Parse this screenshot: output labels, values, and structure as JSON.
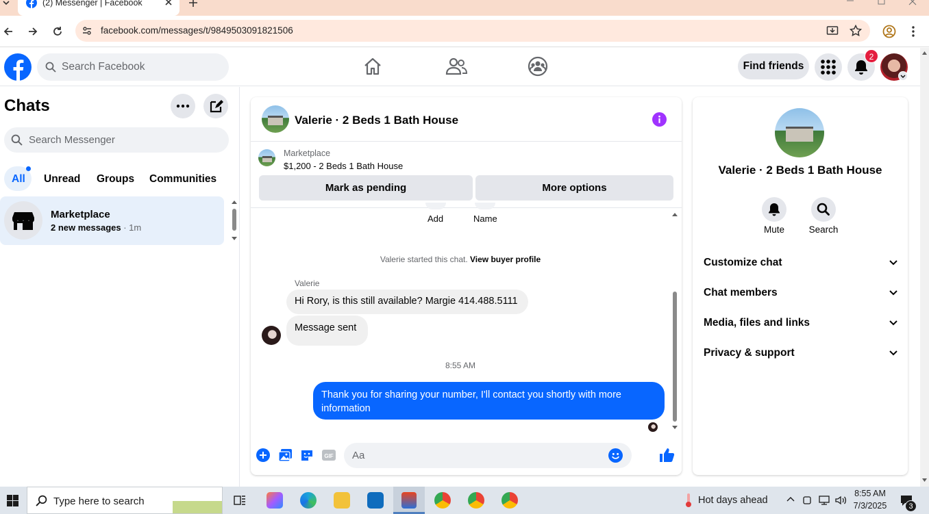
{
  "browser": {
    "tab_title": "(2) Messenger | Facebook",
    "url": "facebook.com/messages/t/9849503091821506"
  },
  "fb_header": {
    "search_placeholder": "Search Facebook",
    "find_friends": "Find friends",
    "notification_count": "2"
  },
  "left": {
    "title": "Chats",
    "search_placeholder": "Search Messenger",
    "filters": [
      "All",
      "Unread",
      "Groups",
      "Communities"
    ],
    "active_filter": "All",
    "chat": {
      "name": "Marketplace",
      "preview": "2 new messages",
      "time": " · 1m"
    }
  },
  "conversation": {
    "title": "Valerie · 2 Beds 1 Bath House",
    "marketplace_label": "Marketplace",
    "listing": "$1,200 - 2 Beds 1 Bath House",
    "mark_pending": "Mark as pending",
    "more_options": "More options",
    "top_actions": [
      "Add",
      "Name"
    ],
    "started_text": "Valerie started this chat.",
    "view_buyer": "View buyer profile",
    "sender": "Valerie",
    "msg1": "Hi Rory, is this still available? Margie 414.488.5111",
    "msg2": "Message sent",
    "timestamp": "8:55 AM",
    "my_msg": "Thank you for sharing your number, I'll contact you shortly with more information",
    "composer_placeholder": "Aa"
  },
  "right": {
    "name": "Valerie · 2 Beds 1 Bath House",
    "mute": "Mute",
    "search": "Search",
    "sections": [
      "Customize chat",
      "Chat members",
      "Media, files and links",
      "Privacy & support"
    ]
  },
  "taskbar": {
    "search_placeholder": "Type here to search",
    "weather": "Hot days ahead",
    "time": "8:55 AM",
    "date": "7/3/2025",
    "notif_count": "3"
  },
  "colors": {
    "fb_blue": "#0866ff",
    "badge_red": "#e41e3f",
    "info_purple": "#a033ff"
  }
}
